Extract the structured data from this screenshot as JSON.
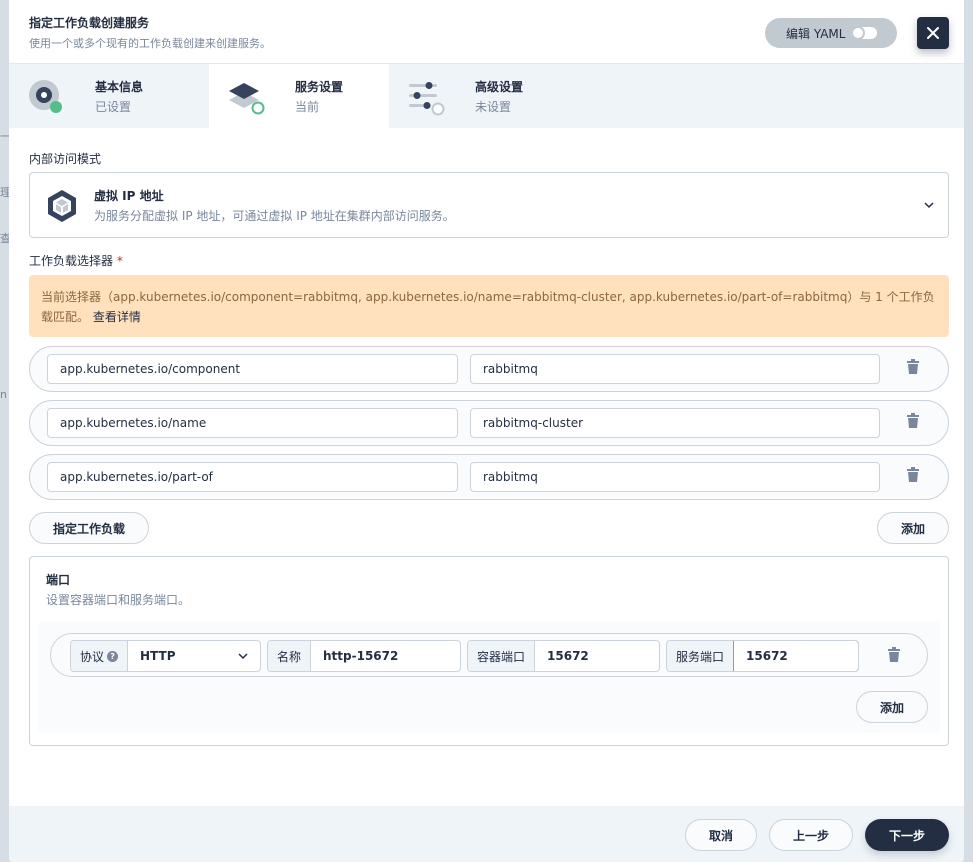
{
  "header": {
    "title": "指定工作负载创建服务",
    "subtitle": "使用一个或多个现有的工作负载创建来创建服务。",
    "yaml_label": "编辑 YAML"
  },
  "tabs": [
    {
      "name": "基本信息",
      "status": "已设置"
    },
    {
      "name": "服务设置",
      "status": "当前"
    },
    {
      "name": "高级设置",
      "status": "未设置"
    }
  ],
  "access_mode": {
    "label": "内部访问模式",
    "title": "虚拟 IP 地址",
    "description": "为服务分配虚拟 IP 地址，可通过虚拟 IP 地址在集群内部访问服务。"
  },
  "selector": {
    "label": "工作负载选择器",
    "required_mark": "*",
    "warning_text": "当前选择器（app.kubernetes.io/component=rabbitmq, app.kubernetes.io/name=rabbitmq-cluster, app.kubernetes.io/part-of=rabbitmq）与 1 个工作负载匹配。",
    "warning_link": "查看详情",
    "rows": [
      {
        "key": "app.kubernetes.io/component",
        "value": "rabbitmq"
      },
      {
        "key": "app.kubernetes.io/name",
        "value": "rabbitmq-cluster"
      },
      {
        "key": "app.kubernetes.io/part-of",
        "value": "rabbitmq"
      }
    ],
    "specify_button": "指定工作负载",
    "add_button": "添加"
  },
  "ports": {
    "title": "端口",
    "description": "设置容器端口和服务端口。",
    "protocol_label": "协议",
    "protocol_value": "HTTP",
    "name_label": "名称",
    "name_value": "http-15672",
    "container_port_label": "容器端口",
    "container_port_value": "15672",
    "service_port_label": "服务端口",
    "service_port_value": "15672",
    "add_button": "添加"
  },
  "footer": {
    "cancel": "取消",
    "prev": "上一步",
    "next": "下一步"
  },
  "colors": {
    "primary_dark": "#242e42",
    "success_green": "#55bc8a",
    "warning_bg": "#ffe1be"
  }
}
